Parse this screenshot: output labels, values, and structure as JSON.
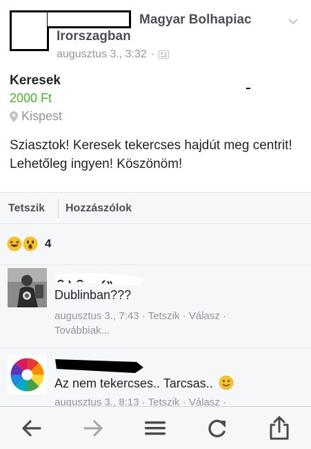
{
  "post": {
    "group_name_line1": "Magyar Bolhapiac",
    "group_name_line2": "Irorszagban",
    "timestamp": "augusztus 3., 3:32",
    "separator": "·",
    "title": "Keresek",
    "price": "2000 Ft",
    "location": "Kispest",
    "body": "Sziasztok! Keresek tekercses hajdút meg centrit! Lehetőleg ingyen! Köszönöm!"
  },
  "actions": {
    "like": "Tetszik",
    "comment": "Hozzászólok"
  },
  "reactions": {
    "icons": [
      "haha-icon",
      "wow-icon"
    ],
    "count": "4"
  },
  "comments": [
    {
      "text": "Dublinban???",
      "time": "augusztus 3., 7:43",
      "like": "Tetszik",
      "reply": "Válasz",
      "more": "Továbbiak..."
    },
    {
      "text": "Az nem tekercses.. Tarcsas..",
      "time": "augusztus 3., 8:13",
      "like": "Tetszik",
      "reply": "Válasz",
      "more": ""
    }
  ],
  "toolbar": {
    "icons": [
      "back-arrow-icon",
      "forward-arrow-icon",
      "menu-icon",
      "reload-icon",
      "share-icon"
    ]
  },
  "colors": {
    "price": "#42b72a",
    "meta": "#90949c",
    "text": "#1d2129",
    "background_gray": "#f6f7f9"
  }
}
